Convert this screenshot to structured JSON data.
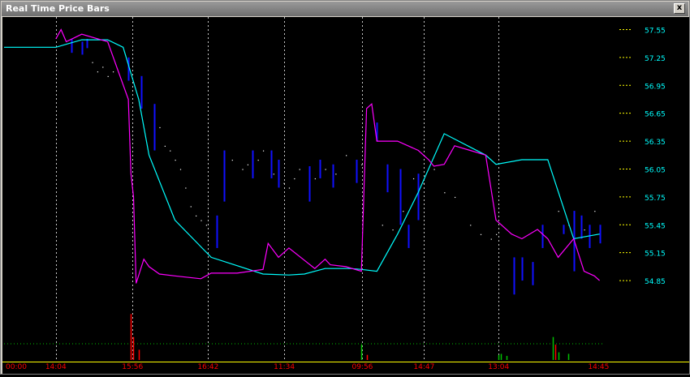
{
  "window": {
    "title": "Real Time Price Bars",
    "close_label": "x"
  },
  "colors": {
    "background": "#000000",
    "grid": "#c8c8c8",
    "price_axis_text": "#00ffff",
    "price_tick_mark": "#ffff00",
    "time_axis_text": "#ff0000",
    "time_axis_line": "#ffff00",
    "average_line": "#00ffff",
    "fast_line": "#ff00ff",
    "bars": "#1010ff",
    "dots": "#ffffff",
    "volume_up": "#00c000",
    "volume_down": "#ff0000"
  },
  "chart_data": {
    "type": "line",
    "title": "",
    "price_labels": [
      "57.55",
      "57.25",
      "56.95",
      "56.65",
      "56.35",
      "56.05",
      "55.75",
      "55.45",
      "55.15",
      "54.85"
    ],
    "ylim": [
      54.65,
      57.65
    ],
    "time_labels": [
      "00:00",
      "14:04",
      "15:56",
      "16:42",
      "11:34",
      "09:56",
      "14:47",
      "13:04",
      "14:45"
    ],
    "time_positions": [
      0,
      0.1,
      0.248,
      0.394,
      0.541,
      0.692,
      0.811,
      0.955,
      1.148
    ],
    "grid_x_index": [
      1,
      2,
      3,
      4,
      5,
      6,
      7
    ],
    "series": [
      {
        "kind": "slow-line",
        "color": "#00ffff",
        "x": [
          0,
          0.1,
          0.15,
          0.2,
          0.23,
          0.26,
          0.28,
          0.33,
          0.4,
          0.5,
          0.55,
          0.58,
          0.62,
          0.67,
          0.69,
          0.72,
          0.76,
          0.8,
          0.85,
          0.93,
          0.95,
          1.0,
          1.05,
          1.1,
          1.15
        ],
        "y": [
          57.36,
          57.36,
          57.44,
          57.44,
          57.36,
          56.8,
          56.2,
          55.5,
          55.1,
          54.92,
          54.91,
          54.92,
          54.98,
          54.98,
          54.97,
          54.95,
          55.35,
          55.8,
          56.43,
          56.2,
          56.1,
          56.15,
          56.15,
          55.3,
          55.35
        ]
      },
      {
        "kind": "fast-line",
        "color": "#ff00ff",
        "x": [
          0.1,
          0.11,
          0.12,
          0.15,
          0.2,
          0.24,
          0.245,
          0.25,
          0.255,
          0.27,
          0.28,
          0.3,
          0.33,
          0.38,
          0.4,
          0.45,
          0.5,
          0.51,
          0.53,
          0.55,
          0.6,
          0.62,
          0.63,
          0.66,
          0.69,
          0.7,
          0.71,
          0.72,
          0.76,
          0.8,
          0.82,
          0.83,
          0.85,
          0.87,
          0.9,
          0.93,
          0.95,
          0.98,
          1.0,
          1.03,
          1.05,
          1.07,
          1.1,
          1.12,
          1.14,
          1.15
        ],
        "y": [
          57.45,
          57.55,
          57.42,
          57.5,
          57.42,
          56.8,
          56.0,
          55.75,
          54.82,
          55.08,
          55.0,
          54.92,
          54.9,
          54.87,
          54.93,
          54.93,
          54.97,
          55.25,
          55.1,
          55.2,
          54.98,
          55.08,
          55.02,
          55.0,
          54.95,
          56.7,
          56.75,
          56.35,
          56.35,
          56.25,
          56.15,
          56.08,
          56.1,
          56.3,
          56.25,
          56.2,
          55.5,
          55.35,
          55.3,
          55.4,
          55.3,
          55.1,
          55.3,
          54.95,
          54.9,
          54.85
        ]
      }
    ],
    "bars": [
      {
        "x": 0.13,
        "low": 57.3,
        "high": 57.45
      },
      {
        "x": 0.15,
        "low": 57.28,
        "high": 57.42
      },
      {
        "x": 0.16,
        "low": 57.35,
        "high": 57.45
      },
      {
        "x": 0.24,
        "low": 57.0,
        "high": 57.25
      },
      {
        "x": 0.265,
        "low": 56.7,
        "high": 57.05
      },
      {
        "x": 0.29,
        "low": 56.25,
        "high": 56.75
      },
      {
        "x": 0.41,
        "low": 55.2,
        "high": 55.55
      },
      {
        "x": 0.425,
        "low": 55.7,
        "high": 56.25
      },
      {
        "x": 0.48,
        "low": 55.95,
        "high": 56.25
      },
      {
        "x": 0.515,
        "low": 55.95,
        "high": 56.25
      },
      {
        "x": 0.53,
        "low": 55.85,
        "high": 56.15
      },
      {
        "x": 0.59,
        "low": 55.7,
        "high": 56.08
      },
      {
        "x": 0.61,
        "low": 55.95,
        "high": 56.15
      },
      {
        "x": 0.635,
        "low": 55.85,
        "high": 56.1
      },
      {
        "x": 0.68,
        "low": 55.9,
        "high": 56.15
      },
      {
        "x": 0.72,
        "low": 56.35,
        "high": 56.55
      },
      {
        "x": 0.74,
        "low": 55.8,
        "high": 56.1
      },
      {
        "x": 0.765,
        "low": 55.45,
        "high": 56.05
      },
      {
        "x": 0.78,
        "low": 55.2,
        "high": 55.45
      },
      {
        "x": 0.8,
        "low": 55.5,
        "high": 56.0
      },
      {
        "x": 0.985,
        "low": 54.7,
        "high": 55.1
      },
      {
        "x": 1.0,
        "low": 54.85,
        "high": 55.1
      },
      {
        "x": 1.02,
        "low": 54.8,
        "high": 55.05
      },
      {
        "x": 1.04,
        "low": 55.2,
        "high": 55.45
      },
      {
        "x": 1.08,
        "low": 55.35,
        "high": 55.45
      },
      {
        "x": 1.1,
        "low": 54.95,
        "high": 55.6
      },
      {
        "x": 1.115,
        "low": 55.3,
        "high": 55.55
      },
      {
        "x": 1.13,
        "low": 55.2,
        "high": 55.45
      },
      {
        "x": 1.15,
        "low": 55.25,
        "high": 55.45
      }
    ],
    "dots": [
      {
        "x": 0.17,
        "y": 57.2
      },
      {
        "x": 0.18,
        "y": 57.1
      },
      {
        "x": 0.19,
        "y": 57.15
      },
      {
        "x": 0.2,
        "y": 57.05
      },
      {
        "x": 0.21,
        "y": 57.1
      },
      {
        "x": 0.3,
        "y": 56.5
      },
      {
        "x": 0.31,
        "y": 56.3
      },
      {
        "x": 0.32,
        "y": 56.25
      },
      {
        "x": 0.33,
        "y": 56.15
      },
      {
        "x": 0.34,
        "y": 56.05
      },
      {
        "x": 0.35,
        "y": 55.85
      },
      {
        "x": 0.36,
        "y": 55.65
      },
      {
        "x": 0.37,
        "y": 55.55
      },
      {
        "x": 0.38,
        "y": 55.5
      },
      {
        "x": 0.39,
        "y": 55.45
      },
      {
        "x": 0.44,
        "y": 56.15
      },
      {
        "x": 0.46,
        "y": 56.05
      },
      {
        "x": 0.47,
        "y": 56.1
      },
      {
        "x": 0.49,
        "y": 56.15
      },
      {
        "x": 0.5,
        "y": 56.25
      },
      {
        "x": 0.52,
        "y": 56.0
      },
      {
        "x": 0.54,
        "y": 55.9
      },
      {
        "x": 0.55,
        "y": 55.85
      },
      {
        "x": 0.56,
        "y": 55.95
      },
      {
        "x": 0.57,
        "y": 56.05
      },
      {
        "x": 0.6,
        "y": 55.95
      },
      {
        "x": 0.62,
        "y": 56.05
      },
      {
        "x": 0.64,
        "y": 56.0
      },
      {
        "x": 0.66,
        "y": 56.2
      },
      {
        "x": 0.69,
        "y": 56.1
      },
      {
        "x": 0.73,
        "y": 55.45
      },
      {
        "x": 0.75,
        "y": 55.4
      },
      {
        "x": 0.77,
        "y": 55.6
      },
      {
        "x": 0.79,
        "y": 55.95
      },
      {
        "x": 0.81,
        "y": 55.9
      },
      {
        "x": 0.83,
        "y": 56.05
      },
      {
        "x": 0.85,
        "y": 55.8
      },
      {
        "x": 0.87,
        "y": 55.75
      },
      {
        "x": 0.9,
        "y": 55.45
      },
      {
        "x": 0.92,
        "y": 55.35
      },
      {
        "x": 0.94,
        "y": 55.3
      },
      {
        "x": 0.95,
        "y": 55.35
      },
      {
        "x": 1.07,
        "y": 55.6
      },
      {
        "x": 1.09,
        "y": 55.45
      },
      {
        "x": 1.12,
        "y": 55.4
      },
      {
        "x": 1.14,
        "y": 55.6
      }
    ],
    "volume": [
      {
        "x": 0.245,
        "v": 0.9,
        "c": "down"
      },
      {
        "x": 0.25,
        "v": 0.45,
        "c": "down"
      },
      {
        "x": 0.26,
        "v": 0.2,
        "c": "down"
      },
      {
        "x": 0.69,
        "v": 0.3,
        "c": "up"
      },
      {
        "x": 0.7,
        "v": 0.1,
        "c": "down"
      },
      {
        "x": 0.955,
        "v": 0.1,
        "c": "up"
      },
      {
        "x": 0.96,
        "v": 0.12,
        "c": "up"
      },
      {
        "x": 0.97,
        "v": 0.08,
        "c": "up"
      },
      {
        "x": 1.06,
        "v": 0.45,
        "c": "up"
      },
      {
        "x": 1.065,
        "v": 0.3,
        "c": "down"
      },
      {
        "x": 1.07,
        "v": 0.15,
        "c": "up"
      },
      {
        "x": 1.09,
        "v": 0.12,
        "c": "up"
      }
    ]
  }
}
